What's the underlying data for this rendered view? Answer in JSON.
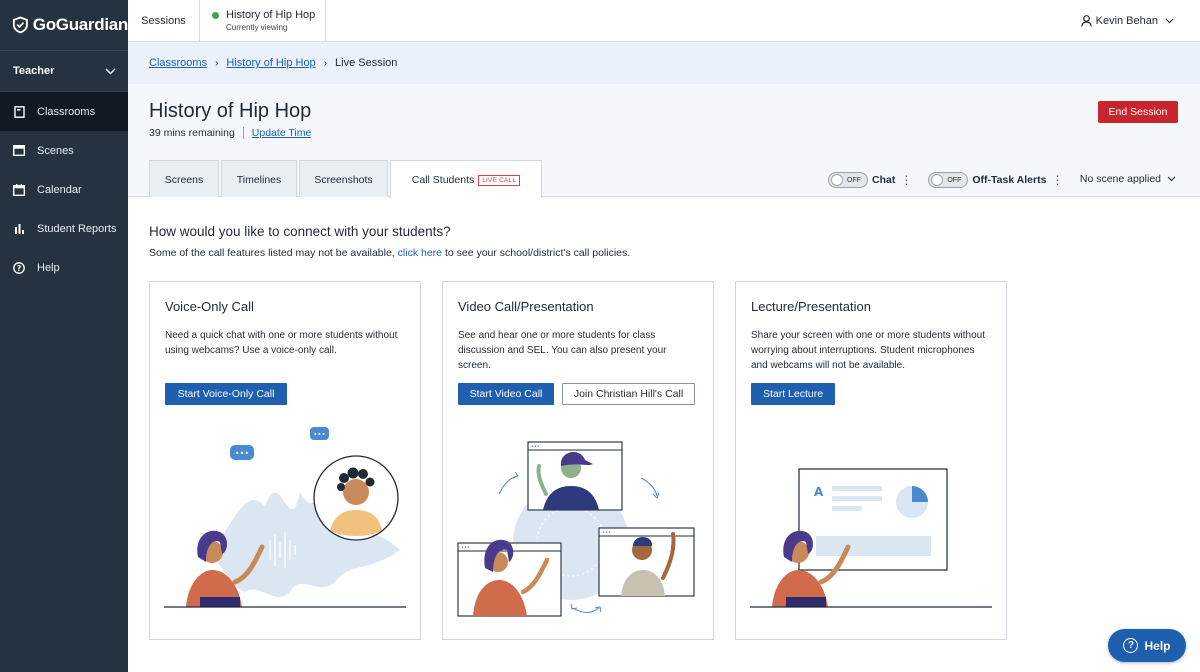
{
  "app": {
    "logo": "GoGuardian"
  },
  "sidebar": {
    "role": "Teacher",
    "items": [
      {
        "label": "Classrooms",
        "icon": "book-icon",
        "active": true
      },
      {
        "label": "Scenes",
        "icon": "scenes-icon"
      },
      {
        "label": "Calendar",
        "icon": "calendar-icon"
      },
      {
        "label": "Student Reports",
        "icon": "bar-chart-icon"
      },
      {
        "label": "Help",
        "icon": "help-icon"
      }
    ]
  },
  "topbar": {
    "sessions_label": "Sessions",
    "current_title": "History of Hip Hop",
    "current_status": "Currently viewing",
    "user_name": "Kevin Behan"
  },
  "breadcrumb": {
    "item1": "Classrooms",
    "item2": "History of Hip Hop",
    "item3": "Live Session"
  },
  "header": {
    "title": "History of Hip Hop",
    "remaining": "39 mins remaining",
    "update_time": "Update Time",
    "end_session": "End Session"
  },
  "tabs": [
    {
      "label": "Screens"
    },
    {
      "label": "Timelines"
    },
    {
      "label": "Screenshots"
    },
    {
      "label": "Call Students",
      "badge": "LIVE CALL",
      "active": true
    }
  ],
  "controls": {
    "chat_toggle_state": "OFF",
    "chat_label": "Chat",
    "offtask_toggle_state": "OFF",
    "offtask_label": "Off-Task Alerts",
    "scene_label": "No scene applied"
  },
  "main": {
    "question": "How would you like to connect with your students?",
    "sub_before": "Some of the call features listed may not be available,",
    "sub_link": "click here",
    "sub_after": "to see your school/district's call policies."
  },
  "cards": [
    {
      "title": "Voice-Only Call",
      "desc": "Need a quick chat with one or more students without using webcams? Use a voice-only call.",
      "primary": "Start Voice-Only Call"
    },
    {
      "title": "Video Call/Presentation",
      "desc": "See and hear one or more students for class discussion and SEL. You can also present your screen.",
      "primary": "Start Video Call",
      "secondary": "Join Christian Hill's Call"
    },
    {
      "title": "Lecture/Presentation",
      "desc": "Share your screen with one or more students without worrying about interruptions. Student microphones and webcams will not be available.",
      "primary": "Start Lecture"
    }
  ],
  "help_button": "Help",
  "colors": {
    "sidebar_bg": "#24333f",
    "accent": "#1f5fb0",
    "danger": "#c9252c",
    "live": "#3aa54a"
  }
}
